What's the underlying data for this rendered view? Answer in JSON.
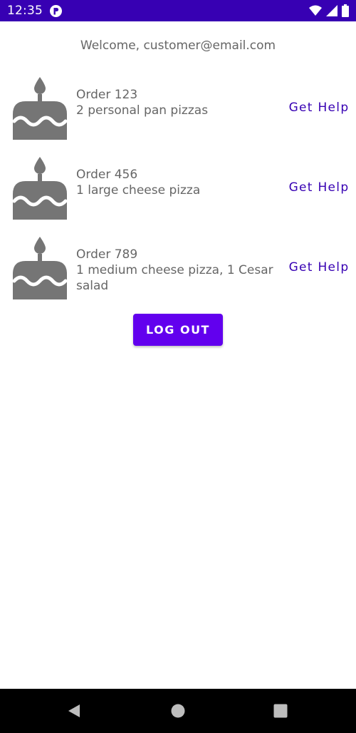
{
  "status_bar": {
    "time": "12:35",
    "app_icon": "notification-app-icon",
    "icons": [
      "wifi-icon",
      "signal-icon",
      "battery-icon"
    ]
  },
  "welcome_text": "Welcome, customer@email.com",
  "orders": [
    {
      "icon": "cake-icon",
      "title": "Order 123",
      "description": "2 personal pan pizzas",
      "action_label": "Get Help"
    },
    {
      "icon": "cake-icon",
      "title": "Order 456",
      "description": "1 large cheese pizza",
      "action_label": "Get Help"
    },
    {
      "icon": "cake-icon",
      "title": "Order 789",
      "description": "1 medium cheese pizza, 1 Cesar salad",
      "action_label": "Get Help"
    }
  ],
  "logout_label": "LOG OUT",
  "nav_bar": {
    "icons": [
      "back-icon",
      "home-icon",
      "recents-icon"
    ]
  },
  "colors": {
    "status_bar": "#3700b3",
    "accent": "#6200ee",
    "link": "#3700b3",
    "icon_gray": "#757575",
    "text_gray": "#666666"
  }
}
